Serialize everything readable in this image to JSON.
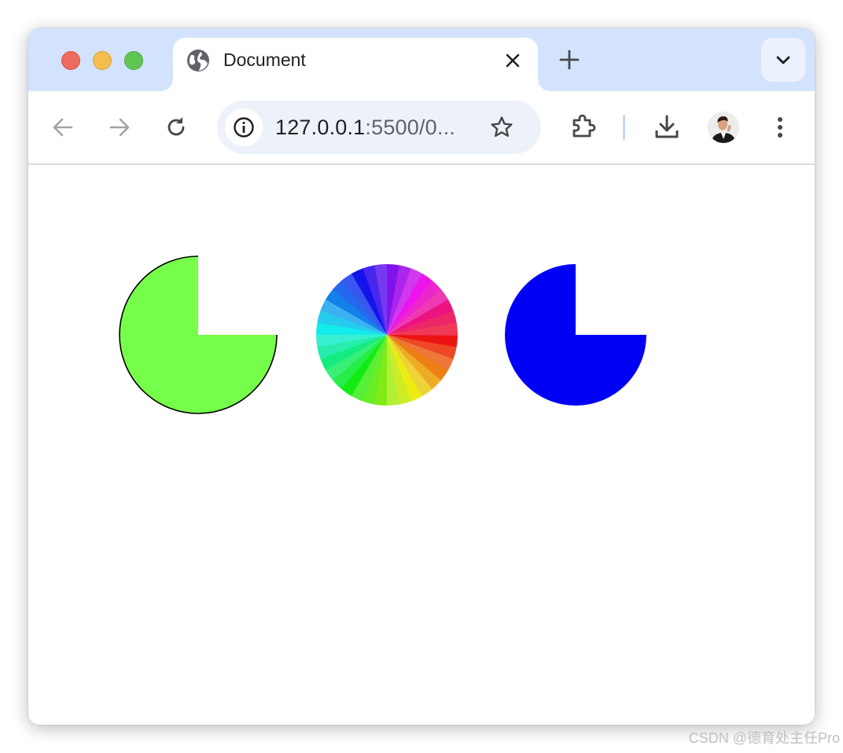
{
  "window": {
    "controls": [
      "close",
      "minimize",
      "maximize"
    ]
  },
  "tab": {
    "title": "Document",
    "favicon": "globe-icon",
    "close_icon": "close-icon"
  },
  "tabstrip": {
    "new_tab_icon": "plus-icon",
    "tab_search_icon": "chevron-down-icon"
  },
  "toolbar": {
    "back_icon": "arrow-left-icon",
    "forward_icon": "arrow-right-icon",
    "reload_icon": "reload-icon",
    "extensions_icon": "puzzle-icon",
    "downloads_icon": "download-icon",
    "menu_icon": "kebab-menu-icon"
  },
  "omnibox": {
    "host": "127.0.0.1",
    "rest": ":5500/0...",
    "site_info_icon": "info-icon",
    "bookmark_icon": "star-icon"
  },
  "canvas": {
    "shapes": [
      {
        "kind": "three-quarter-circle",
        "fill": "#76ff4a",
        "stroke": "#000000"
      },
      {
        "kind": "color-wheel",
        "segments": 36
      },
      {
        "kind": "three-quarter-circle",
        "fill": "#0000f5"
      }
    ]
  },
  "watermark": "CSDN @德育处主任Pro",
  "colors": {
    "tabstrip_bg": "#d3e3fd",
    "omnibox_bg": "#edf2fa",
    "green_shape": "#76ff4a",
    "blue_shape": "#0000f5"
  }
}
